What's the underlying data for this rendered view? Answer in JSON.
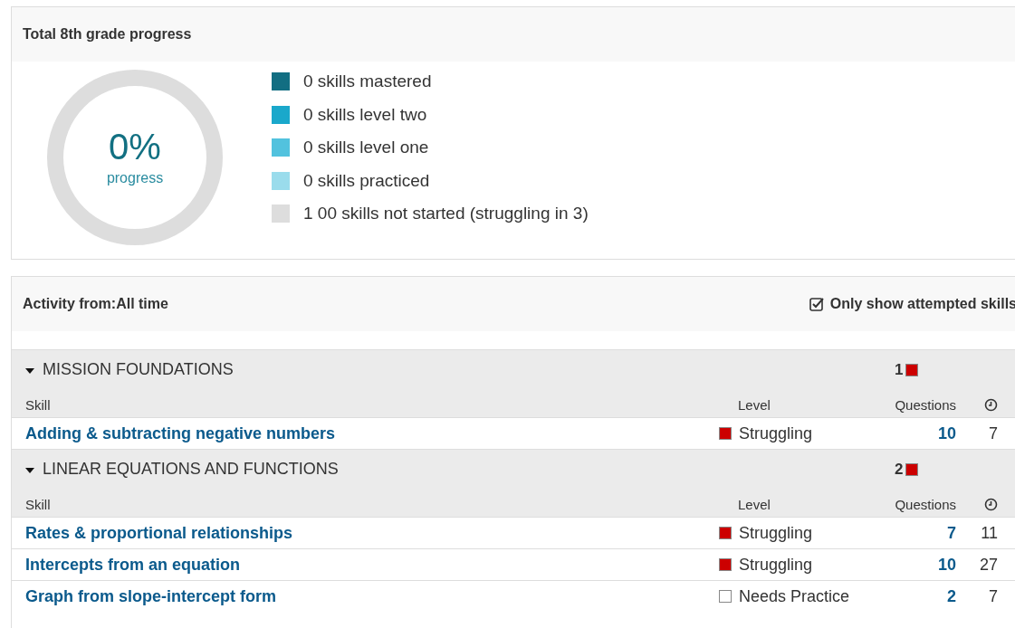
{
  "progress_panel": {
    "title": "Total 8th grade progress",
    "donut": {
      "percent": "0%",
      "caption": "progress",
      "level": 0
    },
    "legend": [
      {
        "label": "0 skills mastered",
        "color": "#126e82"
      },
      {
        "label": "0 skills level two",
        "color": "#1aa8cb"
      },
      {
        "label": "0 skills level one",
        "color": "#52c2de"
      },
      {
        "label": "0 skills practiced",
        "color": "#9adcec"
      },
      {
        "label": "1 00 skills not started (struggling in 3)",
        "color": "#dddddd"
      }
    ]
  },
  "activity_panel": {
    "filter_label": "Activity from:",
    "filter_value": "All time",
    "toggle": {
      "label": "Only show attempted skills",
      "checked": true
    },
    "groups": [
      {
        "title": "MISSION FOUNDATIONS",
        "expanded": true,
        "struggling_count": "1",
        "columns": [
          "Skill",
          "Level",
          "Questions"
        ],
        "rows": [
          {
            "skill": "Adding & subtracting negative numbers",
            "level": "Struggling",
            "kind": "struggling",
            "questions": "10",
            "time": "7"
          }
        ]
      },
      {
        "title": "LINEAR EQUATIONS AND FUNCTIONS",
        "expanded": true,
        "struggling_count": "2",
        "columns": [
          "Skill",
          "Level",
          "Questions"
        ],
        "rows": [
          {
            "skill": "Rates & proportional relationships",
            "level": "Struggling",
            "kind": "struggling",
            "questions": "7",
            "time": "11"
          },
          {
            "skill": "Intercepts from an equation",
            "level": "Struggling",
            "kind": "struggling",
            "questions": "10",
            "time": "27"
          },
          {
            "skill": "Graph from slope-intercept form",
            "level": "Needs Practice",
            "kind": "needs_practice",
            "questions": "2",
            "time": "7"
          }
        ]
      }
    ]
  }
}
